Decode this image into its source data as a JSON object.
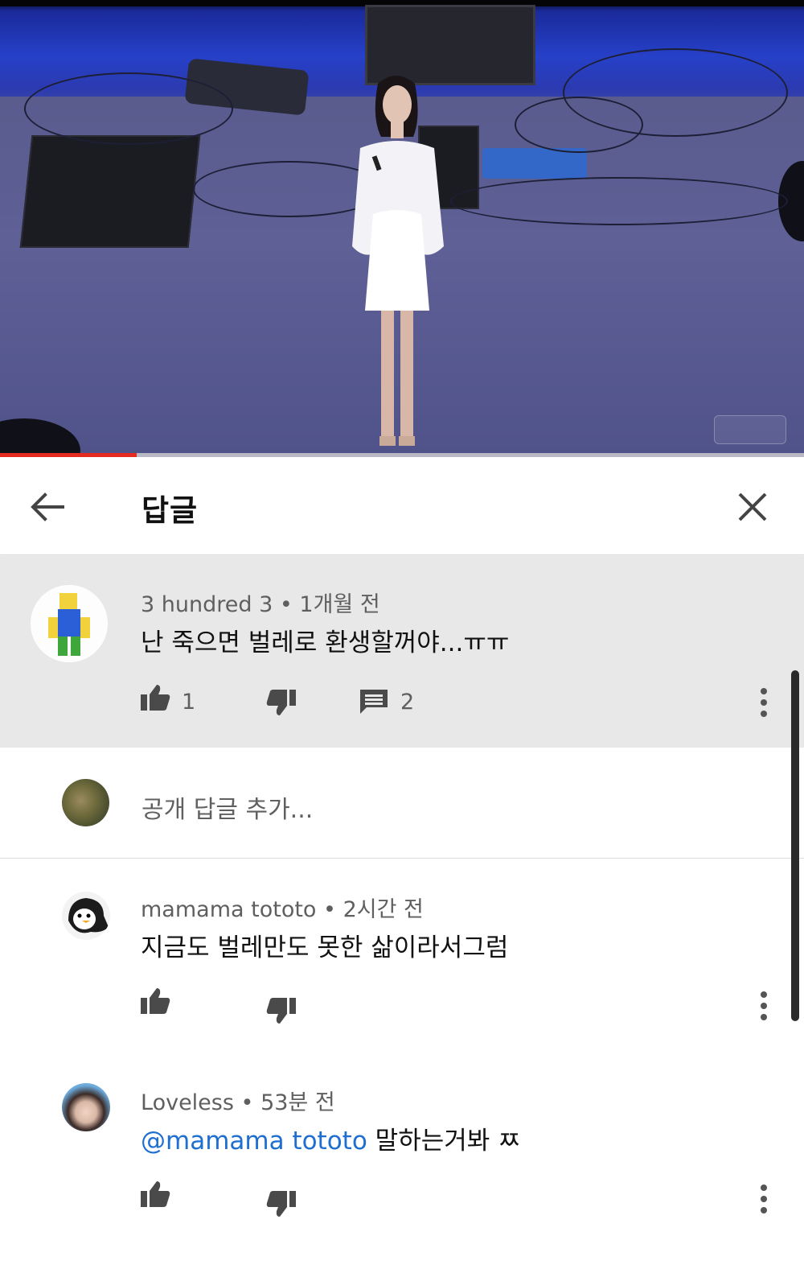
{
  "video": {
    "progress_percent": 17
  },
  "header": {
    "title": "답글"
  },
  "parent_comment": {
    "author": "3 hundred 3",
    "time": "1개월 전",
    "text": "난 죽으면 벌레로 환생할꺼야...ㅠㅠ",
    "likes": "1",
    "replies": "2"
  },
  "add_reply": {
    "placeholder": "공개 답글 추가..."
  },
  "replies": [
    {
      "author": "mamama tototo",
      "time": "2시간 전",
      "text": "지금도 벌레만도 못한 삶이라서그럼"
    },
    {
      "author": "Loveless",
      "time": "53분 전",
      "mention": "@mamama tototo",
      "text": "말하는거봐 ㅉ"
    }
  ],
  "separator": "•",
  "colors": {
    "progress": "#e52a1f",
    "mention": "#1e6fd0",
    "parent_bg": "#e8e8e8"
  }
}
